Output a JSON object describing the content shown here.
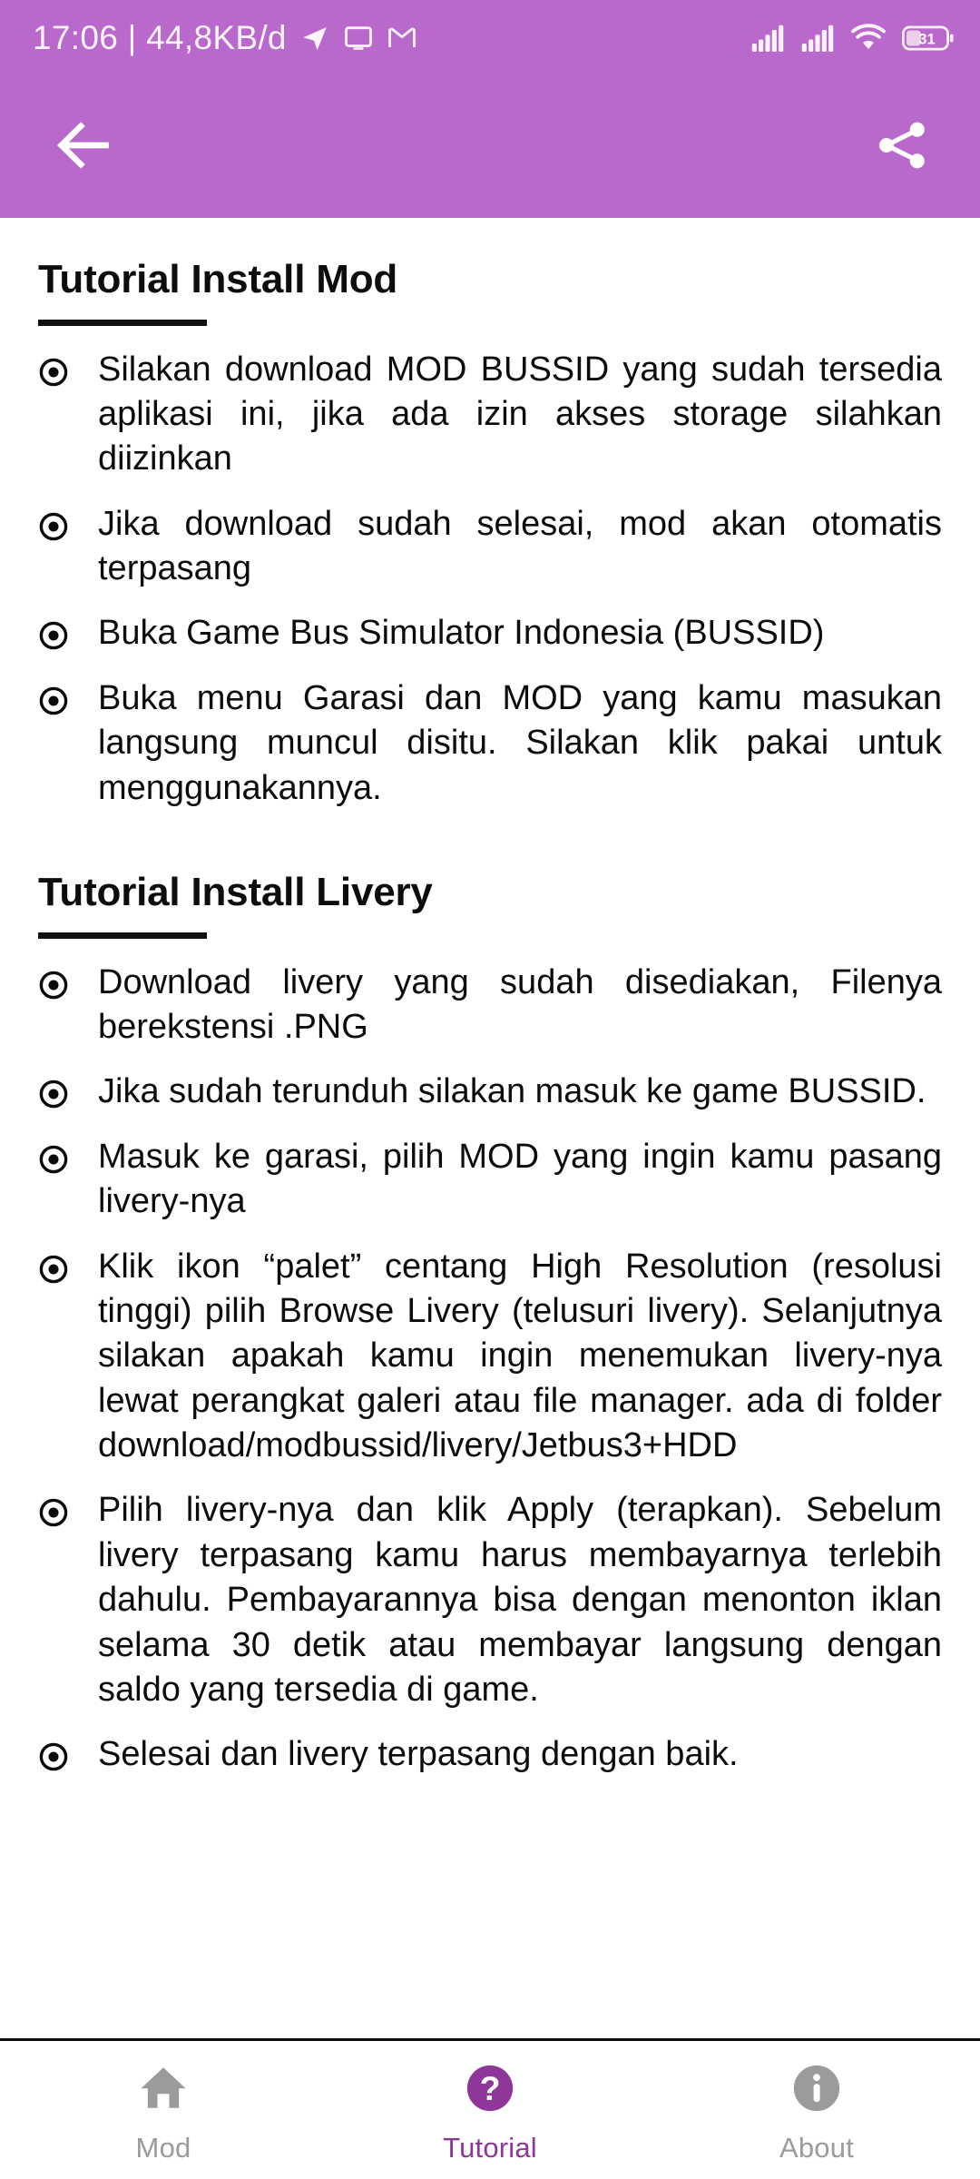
{
  "theme": {
    "appbar_color": "#b968cb",
    "accent_color": "#8e3699",
    "inactive_color": "#9b9b9b",
    "text_color": "#0c0c0c"
  },
  "statusbar": {
    "clock": "17:06 | 44,8KB/d",
    "left_icons": [
      "telegram-icon",
      "cast-screen-icon",
      "gmail-icon"
    ],
    "right_icons": [
      "signal-bars-sim1-icon",
      "signal-bars-sim2-icon",
      "wifi-icon",
      "battery-icon"
    ],
    "battery_level": "31"
  },
  "appbar": {
    "back_icon": "back-arrow-icon",
    "share_icon": "share-icon"
  },
  "content": {
    "sections": [
      {
        "title": "Tutorial Install Mod",
        "bullets": [
          "Silakan download MOD BUSSID yang sudah tersedia aplikasi ini, jika ada izin akses storage silahkan diizinkan",
          "Jika download sudah selesai, mod akan otomatis terpasang",
          "Buka Game Bus Simulator Indonesia (BUSSID)",
          "Buka menu Garasi dan MOD yang kamu masukan langsung muncul disitu. Silakan klik pakai untuk menggunakannya."
        ]
      },
      {
        "title": "Tutorial Install Livery",
        "bullets": [
          "Download livery yang sudah disediakan, Filenya berekstensi .PNG",
          "Jika sudah terunduh silakan masuk ke game BUSSID.",
          "Masuk ke garasi, pilih MOD yang ingin kamu pasang livery-nya",
          "Klik ikon “palet” centang High Resolution (resolusi tinggi) pilih Browse Livery (telusuri livery). Selanjutnya silakan apakah kamu ingin menemukan livery-nya lewat perangkat galeri atau file manager. ada di folder download/modbussid/livery/Jetbus3+HDD",
          "Pilih livery-nya dan klik Apply (terapkan). Sebelum livery terpasang kamu harus membayarnya terlebih dahulu. Pembayarannya bisa dengan menonton iklan selama 30 detik atau membayar langsung dengan saldo yang tersedia di game.",
          "Selesai dan livery terpasang dengan baik."
        ]
      }
    ]
  },
  "bottomnav": {
    "items": [
      {
        "label": "Mod",
        "icon": "home-icon",
        "active": false
      },
      {
        "label": "Tutorial",
        "icon": "help-circle-icon",
        "active": true
      },
      {
        "label": "About",
        "icon": "info-circle-icon",
        "active": false
      }
    ]
  }
}
